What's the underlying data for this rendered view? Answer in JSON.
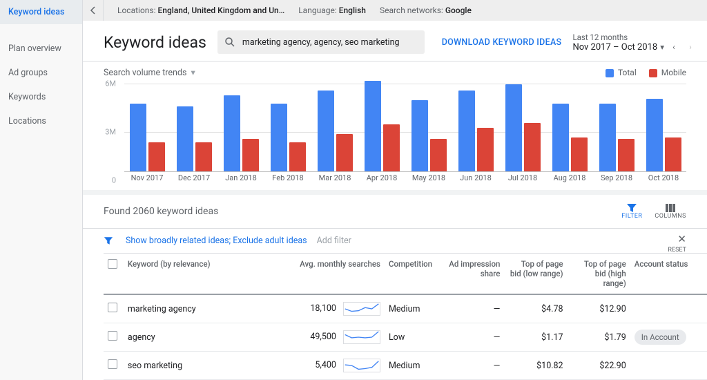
{
  "sidebar": {
    "items": [
      "Keyword ideas",
      "Plan overview",
      "Ad groups",
      "Keywords",
      "Locations"
    ],
    "active_index": 0
  },
  "context": {
    "locations_label": "Locations:",
    "locations_value": "England, United Kingdom and Un…",
    "language_label": "Language:",
    "language_value": "English",
    "networks_label": "Search networks:",
    "networks_value": "Google"
  },
  "header": {
    "title": "Keyword ideas",
    "search_value": "marketing agency, agency, seo marketing",
    "download_label": "DOWNLOAD KEYWORD IDEAS",
    "date_hint": "Last 12 months",
    "date_range": "Nov 2017 – Oct 2018"
  },
  "chart": {
    "dropdown": "Search volume trends",
    "legend": {
      "total": "Total",
      "mobile": "Mobile"
    }
  },
  "chart_data": {
    "type": "bar",
    "categories": [
      "Nov 2017",
      "Dec 2017",
      "Jan 2018",
      "Feb 2018",
      "Mar 2018",
      "Apr 2018",
      "May 2018",
      "Jun 2018",
      "Jul 2018",
      "Aug 2018",
      "Sep 2018",
      "Oct 2018"
    ],
    "series": [
      {
        "name": "Total",
        "values": [
          4.2,
          4.0,
          4.7,
          4.2,
          5.0,
          5.6,
          4.4,
          5.0,
          5.4,
          4.2,
          4.2,
          4.5
        ]
      },
      {
        "name": "Mobile",
        "values": [
          1.8,
          1.8,
          2.0,
          1.8,
          2.3,
          2.9,
          2.0,
          2.7,
          3.0,
          2.1,
          2.0,
          2.1
        ]
      }
    ],
    "ylabel": "",
    "ylim": [
      0,
      6
    ],
    "yticks": [
      0,
      3,
      6
    ],
    "ytick_labels": [
      "0",
      "3M",
      "6M"
    ],
    "unit": "M"
  },
  "results": {
    "found_text": "Found 2060 keyword ideas",
    "tools": {
      "filter": "FILTER",
      "columns": "COLUMNS"
    },
    "filters": {
      "pill": "Show broadly related ideas; Exclude adult ideas",
      "add": "Add filter",
      "reset": "RESET"
    },
    "columns": [
      "Keyword (by relevance)",
      "Avg. monthly searches",
      "Competition",
      "Ad impression share",
      "Top of page bid (low range)",
      "Top of page bid (high range)",
      "Account status"
    ],
    "rows": [
      {
        "keyword": "marketing agency",
        "avg": "18,100",
        "spark": [
          0.5,
          0.3,
          0.35,
          0.6,
          0.5,
          0.9
        ],
        "competition": "Medium",
        "impression": "—",
        "bid_low": "$4.78",
        "bid_high": "$12.90",
        "status": ""
      },
      {
        "keyword": "agency",
        "avg": "49,500",
        "spark": [
          0.7,
          0.45,
          0.5,
          0.45,
          0.5,
          0.95
        ],
        "competition": "Low",
        "impression": "—",
        "bid_low": "$1.17",
        "bid_high": "$1.79",
        "status": "In Account"
      },
      {
        "keyword": "seo marketing",
        "avg": "5,400",
        "spark": [
          0.55,
          0.5,
          0.2,
          0.25,
          0.35,
          0.85
        ],
        "competition": "Medium",
        "impression": "—",
        "bid_low": "$10.82",
        "bid_high": "$22.90",
        "status": ""
      }
    ]
  }
}
